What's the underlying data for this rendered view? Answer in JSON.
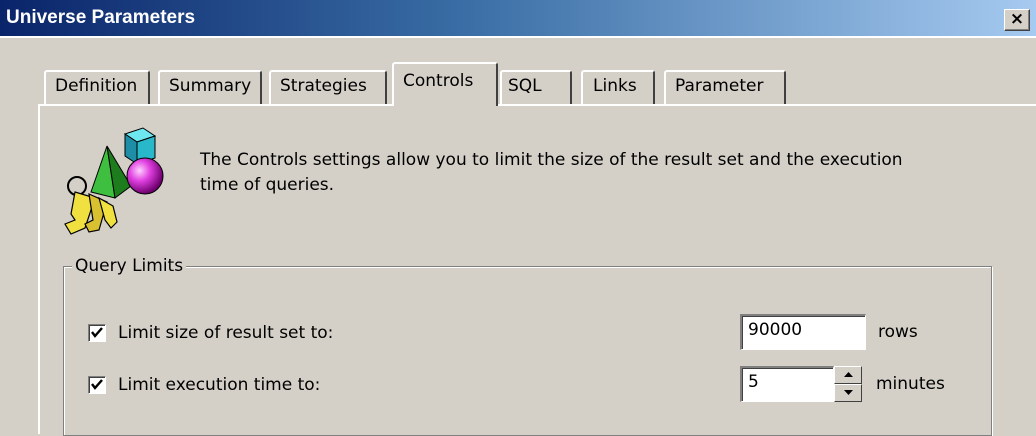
{
  "window": {
    "title": "Universe Parameters",
    "close_glyph": "×",
    "title_gradient": [
      "#0a246a",
      "#a6caf0"
    ]
  },
  "tabs": [
    {
      "label": "Definition",
      "active": false
    },
    {
      "label": "Summary",
      "active": false
    },
    {
      "label": "Strategies",
      "active": false
    },
    {
      "label": "Controls",
      "active": true
    },
    {
      "label": "SQL",
      "active": false
    },
    {
      "label": "Links",
      "active": false
    },
    {
      "label": "Parameter",
      "active": false
    }
  ],
  "controls": {
    "icon": "keys-and-shapes-icon",
    "description": "The Controls settings allow you to limit the size of the result set and the execution time of queries.",
    "query_limits": {
      "legend": "Query Limits",
      "limit_size": {
        "checked": true,
        "label": "Limit size of result set to:",
        "value": "90000",
        "unit": "rows"
      },
      "limit_time": {
        "checked": true,
        "label": "Limit execution time to:",
        "value": "5",
        "unit": "minutes"
      }
    }
  }
}
